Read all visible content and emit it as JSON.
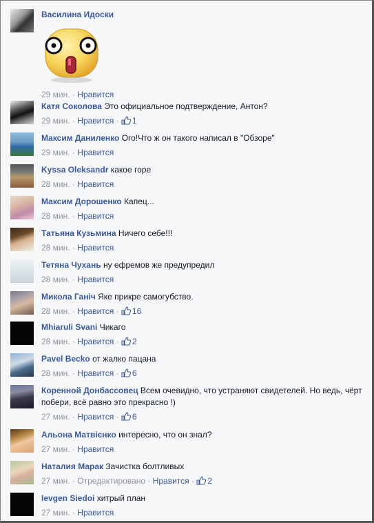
{
  "colors": {
    "link": "#3b5998",
    "meta": "#90949c",
    "background": "#f6f7f9"
  },
  "comments": [
    {
      "author": "Василина Идоски",
      "text": "",
      "time": "29 мин.",
      "like_label": "Нравится",
      "sticker": "surprised-face-sticker"
    },
    {
      "author": "Катя Соколова",
      "text": "Это официальное подтверждение, Антон?",
      "time": "29 мин.",
      "like_label": "Нравится",
      "likes": "1"
    },
    {
      "author": "Максим Даниленко",
      "text": "Ого!Что ж он такого написал в \"Обзоре\"",
      "time": "29 мин.",
      "like_label": "Нравится"
    },
    {
      "author": "Kyssa Oleksandr",
      "text": "какое горе",
      "time": "28 мин.",
      "like_label": "Нравится"
    },
    {
      "author": "Максим Дорошенко",
      "text": "Капец...",
      "time": "28 мин.",
      "like_label": "Нравится"
    },
    {
      "author": "Татьяна Кузьмина",
      "text": "Ничего себе!!!",
      "time": "28 мин.",
      "like_label": "Нравится"
    },
    {
      "author": "Тетяна Чухань",
      "text": "ну ефремов же предупредил",
      "time": "28 мин.",
      "like_label": "Нравится"
    },
    {
      "author": "Микола Ганіч",
      "text": "Яке прикре самогубство.",
      "time": "28 мин.",
      "like_label": "Нравится",
      "likes": "16"
    },
    {
      "author": "Mhiaruli Svani",
      "text": "Чикаго",
      "time": "28 мин.",
      "like_label": "Нравится",
      "likes": "2"
    },
    {
      "author": "Pavel Becko",
      "text": "от жалко пацана",
      "time": "28 мин.",
      "like_label": "Нравится",
      "likes": "6"
    },
    {
      "author": "Коренной Донбассовец",
      "text": "Всем очевидно, что устраняют свидетелей. Но ведь, чёрт побери, всё равно это прекрасно !)",
      "time": "27 мин.",
      "like_label": "Нравится",
      "likes": "6"
    },
    {
      "author": "Альона Матвієнко",
      "text": "интересно, что он знал?",
      "time": "27 мин.",
      "like_label": "Нравится"
    },
    {
      "author": "Наталия Марак",
      "text": "Зачистка болтливых",
      "time": "27 мин.",
      "edited": "Отредактировано",
      "like_label": "Нравится",
      "likes": "2"
    },
    {
      "author": "Ievgen Siedoi",
      "text": "хитрый план",
      "time": "27 мин.",
      "like_label": "Нравится"
    }
  ]
}
